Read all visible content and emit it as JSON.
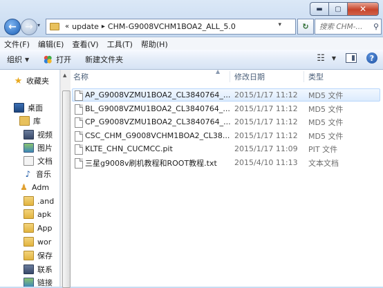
{
  "window": {
    "caption": {
      "minimize": "▬",
      "maximize": "▢",
      "close": "✕"
    }
  },
  "nav": {
    "back_icon": "back-arrow-icon",
    "forward_icon": "forward-arrow-icon",
    "breadcrumb_prefix": "«",
    "breadcrumb": [
      "update",
      "CHM-G9008VCHM1BOA2_ALL_5.0"
    ],
    "search_placeholder": "搜索 CHM-..."
  },
  "menu": [
    "文件(F)",
    "编辑(E)",
    "查看(V)",
    "工具(T)",
    "帮助(H)"
  ],
  "toolbar": {
    "organize": "组织",
    "open": "打开",
    "new_folder": "新建文件夹"
  },
  "nav_pane": {
    "favorites": "收藏夹",
    "desktop": "桌面",
    "libraries": "库",
    "library_items": [
      "视频",
      "图片",
      "文档",
      "音乐"
    ],
    "user": "Adm",
    "folders": [
      ".and",
      "apk",
      "App",
      "wor",
      "保存",
      "联系",
      "链接"
    ]
  },
  "columns": {
    "name": "名称",
    "date": "修改日期",
    "type": "类型"
  },
  "files": [
    {
      "name": "AP_G9008VZMU1BOA2_CL3840764_...",
      "date": "2015/1/17 11:12",
      "type": "MD5 文件",
      "selected": true
    },
    {
      "name": "BL_G9008VZMU1BOA2_CL3840764_...",
      "date": "2015/1/17 11:12",
      "type": "MD5 文件"
    },
    {
      "name": "CP_G9008VZMU1BOA2_CL3840764_...",
      "date": "2015/1/17 11:12",
      "type": "MD5 文件"
    },
    {
      "name": "CSC_CHM_G9008VCHM1BOA2_CL38...",
      "date": "2015/1/17 11:12",
      "type": "MD5 文件"
    },
    {
      "name": "KLTE_CHN_CUCMCC.pit",
      "date": "2015/1/17 11:09",
      "type": "PIT 文件"
    },
    {
      "name": "三星g9008v刷机教程和ROOT教程.txt",
      "date": "2015/4/10 11:13",
      "type": "文本文档"
    }
  ]
}
